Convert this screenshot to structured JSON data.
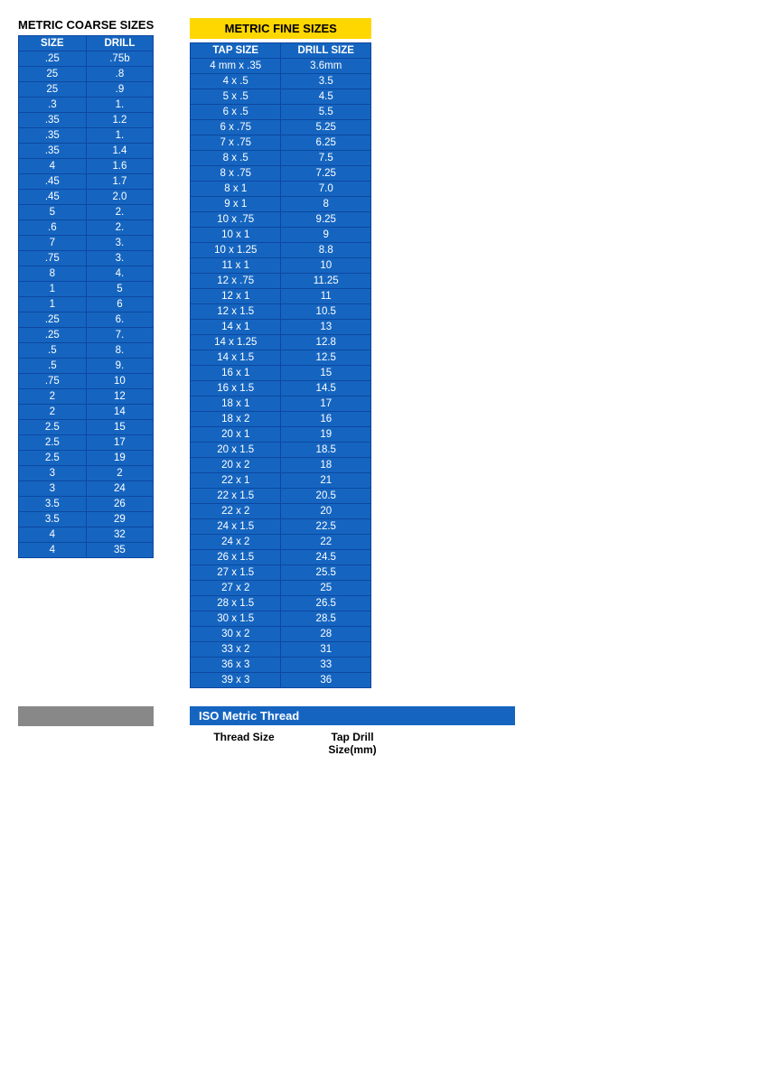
{
  "coarse": {
    "title": "METRIC COARSE SIZES",
    "headers": [
      "SIZE",
      "DRILL"
    ],
    "rows": [
      [
        ".25",
        ".75b"
      ],
      [
        "25",
        ".8"
      ],
      [
        "25",
        ".9"
      ],
      [
        ".3",
        "1."
      ],
      [
        ".35",
        "1.2"
      ],
      [
        ".35",
        "1."
      ],
      [
        ".35",
        "1.4"
      ],
      [
        "4",
        "1.6"
      ],
      [
        ".45",
        "1.7"
      ],
      [
        ".45",
        "2.0"
      ],
      [
        "5",
        "2."
      ],
      [
        ".6",
        "2."
      ],
      [
        "7",
        "3."
      ],
      [
        ".75",
        "3."
      ],
      [
        "8",
        "4."
      ],
      [
        "1",
        "5"
      ],
      [
        "1",
        "6"
      ],
      [
        ".25",
        "6."
      ],
      [
        ".25",
        "7."
      ],
      [
        ".5",
        "8."
      ],
      [
        ".5",
        "9."
      ],
      [
        ".75",
        "10"
      ],
      [
        "2",
        "12"
      ],
      [
        "2",
        "14"
      ],
      [
        "2.5",
        "15"
      ],
      [
        "2.5",
        "17"
      ],
      [
        "2.5",
        "19"
      ],
      [
        "3",
        "2"
      ],
      [
        "3",
        "24"
      ],
      [
        "3.5",
        "26"
      ],
      [
        "3.5",
        "29"
      ],
      [
        "4",
        "32"
      ],
      [
        "4",
        "35"
      ]
    ]
  },
  "fine": {
    "title": "METRIC FINE SIZES",
    "headers": [
      "TAP SIZE",
      "DRILL SIZE"
    ],
    "rows": [
      [
        "4 mm x .35",
        "3.6mm"
      ],
      [
        "4 x .5",
        "3.5"
      ],
      [
        "5 x .5",
        "4.5"
      ],
      [
        "6 x .5",
        "5.5"
      ],
      [
        "6 x .75",
        "5.25"
      ],
      [
        "7 x .75",
        "6.25"
      ],
      [
        "8 x .5",
        "7.5"
      ],
      [
        "8 x .75",
        "7.25"
      ],
      [
        "8 x 1",
        "7.0"
      ],
      [
        "9 x 1",
        "8"
      ],
      [
        "10 x .75",
        "9.25"
      ],
      [
        "10 x 1",
        "9"
      ],
      [
        "10 x 1.25",
        "8.8"
      ],
      [
        "11 x 1",
        "10"
      ],
      [
        "12 x .75",
        "11.25"
      ],
      [
        "12 x 1",
        "11"
      ],
      [
        "12 x 1.5",
        "10.5"
      ],
      [
        "14 x 1",
        "13"
      ],
      [
        "14 x 1.25",
        "12.8"
      ],
      [
        "14 x 1.5",
        "12.5"
      ],
      [
        "16 x 1",
        "15"
      ],
      [
        "16 x 1.5",
        "14.5"
      ],
      [
        "18 x 1",
        "17"
      ],
      [
        "18 x 2",
        "16"
      ],
      [
        "20 x 1",
        "19"
      ],
      [
        "20 x 1.5",
        "18.5"
      ],
      [
        "20 x 2",
        "18"
      ],
      [
        "22 x 1",
        "21"
      ],
      [
        "22 x 1.5",
        "20.5"
      ],
      [
        "22 x 2",
        "20"
      ],
      [
        "24 x 1.5",
        "22.5"
      ],
      [
        "24 x 2",
        "22"
      ],
      [
        "26 x 1.5",
        "24.5"
      ],
      [
        "27 x 1.5",
        "25.5"
      ],
      [
        "27 x 2",
        "25"
      ],
      [
        "28 x 1.5",
        "26.5"
      ],
      [
        "30 x 1.5",
        "28.5"
      ],
      [
        "30 x 2",
        "28"
      ],
      [
        "33 x 2",
        "31"
      ],
      [
        "36 x 3",
        "33"
      ],
      [
        "39 x 3",
        "36"
      ]
    ]
  },
  "bottom": {
    "iso_title": "ISO Metric Thread",
    "col1": "Thread Size",
    "col2": "Tap Drill\nSize(mm)"
  }
}
